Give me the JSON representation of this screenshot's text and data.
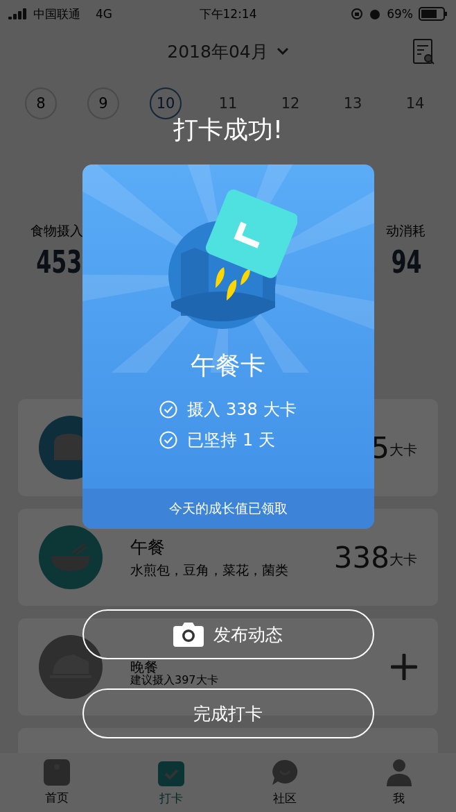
{
  "status_bar": {
    "carrier": "中国联通",
    "network": "4G",
    "time": "下午12:14",
    "battery": "69%"
  },
  "header": {
    "month": "2018年04月"
  },
  "dates": [
    {
      "day": "8",
      "selected": false,
      "past": true
    },
    {
      "day": "9",
      "selected": false,
      "past": true
    },
    {
      "day": "10",
      "selected": true,
      "past": true
    },
    {
      "day": "11",
      "selected": false,
      "past": false
    },
    {
      "day": "12",
      "selected": false,
      "past": false
    },
    {
      "day": "13",
      "selected": false,
      "past": false
    },
    {
      "day": "14",
      "selected": false,
      "past": false
    }
  ],
  "summary": {
    "intake_label": "食物摄入",
    "intake_value": "453",
    "burn_label": "动消耗",
    "burn_value": "94"
  },
  "meals": [
    {
      "kind": "breakfast",
      "value": "5",
      "unit": "大卡"
    },
    {
      "kind": "lunch",
      "title": "午餐",
      "subtitle": "水煎包，豆角，菜花，菌类",
      "value": "338",
      "unit": "大卡"
    },
    {
      "kind": "dinner",
      "title": "晚餐",
      "subtitle": "建议摄入397大卡"
    },
    {
      "kind": "empty"
    }
  ],
  "overlay": {
    "title": "打卡成功!",
    "card": {
      "name": "午餐卡",
      "checks": [
        "摄入 338 大卡",
        "已坚持 1 天"
      ],
      "footer": "今天的成长值已领取"
    },
    "buttons": [
      {
        "kind": "share",
        "label": "发布动态"
      },
      {
        "kind": "done",
        "label": "完成打卡"
      }
    ]
  },
  "tabs": [
    {
      "label": "首页",
      "selected": false
    },
    {
      "label": "打卡",
      "selected": true
    },
    {
      "label": "社区",
      "selected": false
    },
    {
      "label": "我",
      "selected": false
    }
  ]
}
